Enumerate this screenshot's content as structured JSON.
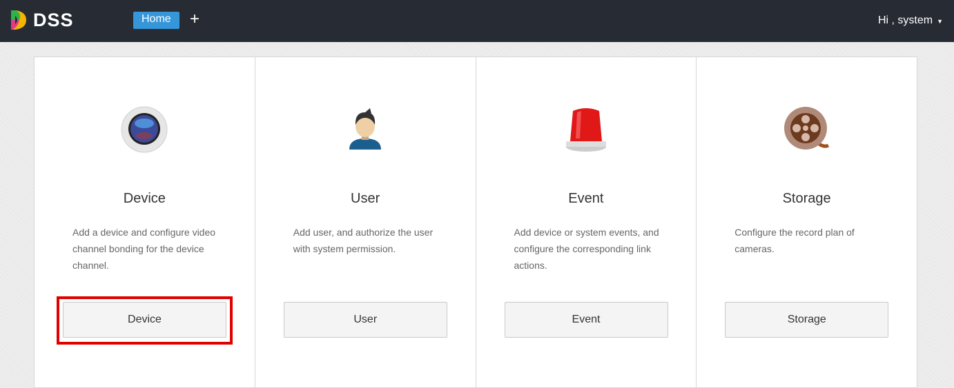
{
  "header": {
    "logo": "DSS",
    "home_tab": "Home",
    "add_tab": "+",
    "greeting": "Hi , system",
    "caret": "▼"
  },
  "cards": [
    {
      "title": "Device",
      "desc": "Add a device and configure video channel bonding for the device channel.",
      "button": "Device"
    },
    {
      "title": "User",
      "desc": "Add user, and authorize the user with system permission.",
      "button": "User"
    },
    {
      "title": "Event",
      "desc": "Add device or system events, and configure the corresponding link actions.",
      "button": "Event"
    },
    {
      "title": "Storage",
      "desc": "Configure the record plan of cameras.",
      "button": "Storage"
    }
  ]
}
